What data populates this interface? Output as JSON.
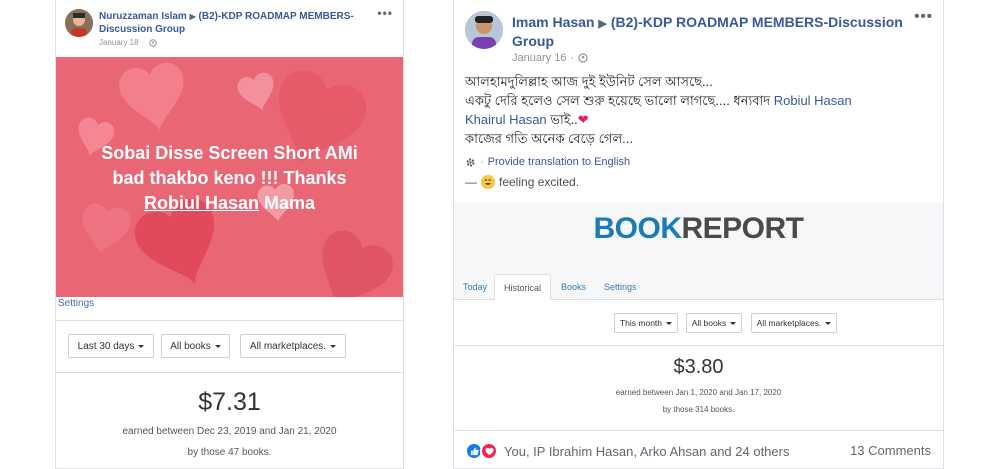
{
  "left_post": {
    "author": "Nuruzzaman Islam",
    "group": "(B2)-KDP ROADMAP MEMBERS-Discussion Group",
    "date": "January 18",
    "more": "•••",
    "hero_line1": "Sobai Disse Screen Short AMi",
    "hero_line2": "bad thakbo keno !!! Thanks",
    "hero_mention": "Robiul Hasan",
    "hero_tail": " Mama",
    "settings": "Settings",
    "filters": {
      "period": "Last 30 days",
      "books": "All books",
      "markets": "All marketplaces."
    },
    "amount": "$7.31",
    "earned": "earned between Dec 23, 2019 and Jan 21, 2020",
    "books_count": "by those 47 books."
  },
  "right_post": {
    "author": "Imam Hasan",
    "group": "(B2)-KDP ROADMAP MEMBERS-Discussion Group",
    "date": "January 16",
    "more": "•••",
    "line1": "আলহামদুলিল্লাহ আজ দুই ইউনিট সেল আসছে...",
    "line2_a": "একটু দেরি হলেও সেল শুরু হয়েছে ভালো লাগছে.... ধন্যবাদ ",
    "mention1": "Robiul Hasan",
    "mention2": "Khairul Hasan",
    "line2_b": " ভাই..",
    "heart": "❤",
    "line3": "কাজের গতি অনেক বেড়ে গেল...",
    "translate_dot": "·",
    "translate": "Provide translation to English",
    "feeling_dash": "—",
    "feeling": "feeling excited.",
    "logo_book": "BOOK",
    "logo_report": "REPORT",
    "tabs": [
      "Today",
      "Historical",
      "Books",
      "Settings"
    ],
    "filters": {
      "period": "This month",
      "books": "All books",
      "markets": "All marketplaces."
    },
    "amount": "$3.80",
    "earned": "earned between Jan 1, 2020 and Jan 17, 2020",
    "books_count": "by those 314 books.",
    "reactions_names": "You, IP Ibrahim Hasan, Arko Ahsan and 24 others",
    "comments": "13 Comments"
  },
  "colors": {
    "hero_bg": "#e96675",
    "link": "#385898",
    "logo_blue": "#1d7ab8"
  }
}
